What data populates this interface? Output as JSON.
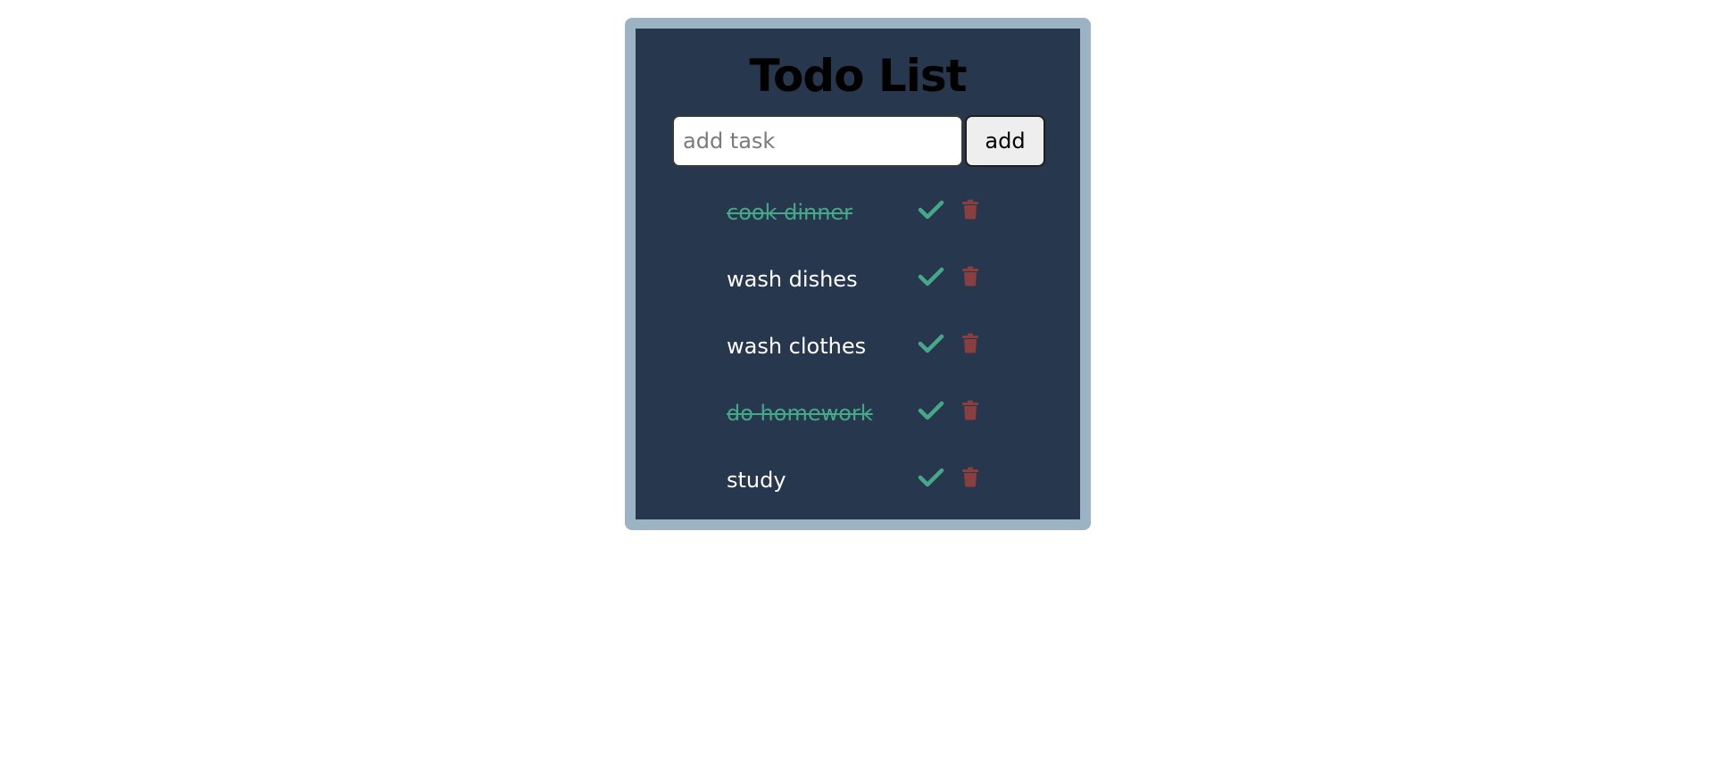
{
  "app": {
    "title": "Todo List"
  },
  "new_task": {
    "placeholder": "add task",
    "value": "",
    "button_label": "add"
  },
  "tasks": [
    {
      "text": "cook dinner",
      "completed": true
    },
    {
      "text": "wash dishes",
      "completed": false
    },
    {
      "text": "wash clothes",
      "completed": false
    },
    {
      "text": "do homework",
      "completed": true
    },
    {
      "text": "study",
      "completed": false
    }
  ],
  "icons": {
    "complete": "check-icon",
    "delete": "trash-icon"
  },
  "colors": {
    "page_background": "#ffffff",
    "frame_border": "#9cb3c4",
    "panel_background": "#27374d",
    "completed_text": "#45a889",
    "check": "#45a889",
    "trash": "#8a3e3e",
    "task_text": "#ffffff"
  }
}
